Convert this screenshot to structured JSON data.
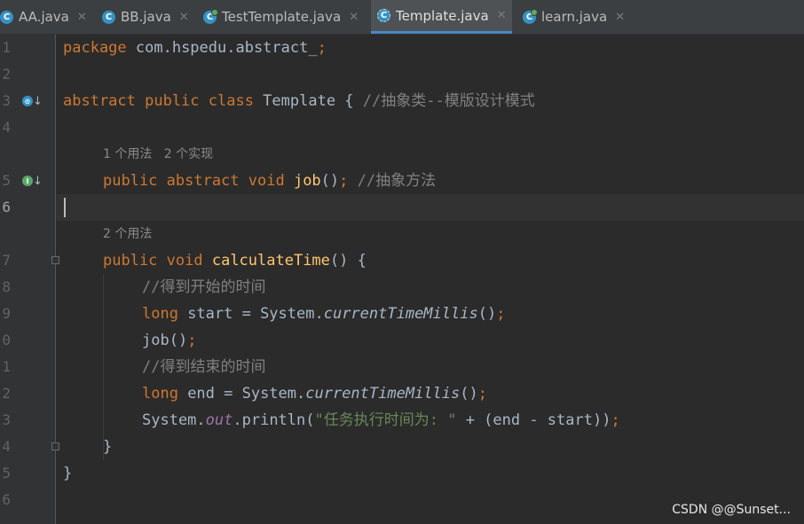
{
  "tabs": [
    {
      "label": "AA.java",
      "icon": "class-icon",
      "active": false
    },
    {
      "label": "BB.java",
      "icon": "class-icon",
      "active": false
    },
    {
      "label": "TestTemplate.java",
      "icon": "runnable-class-icon",
      "active": false
    },
    {
      "label": "Template.java",
      "icon": "abstract-class-icon",
      "active": true
    },
    {
      "label": "learn.java",
      "icon": "runnable-class-icon",
      "active": false
    }
  ],
  "tab_icon_letter": "C",
  "close_glyph": "✕",
  "editor": {
    "current_line": "6",
    "line_numbers": [
      "1",
      "2",
      "3",
      "4",
      "5",
      "6",
      "7",
      "8",
      "9",
      "0",
      "1",
      "2",
      "3",
      "4",
      "5",
      "6"
    ],
    "hints": {
      "abstract_method": "1 个用法   2 个实现",
      "calculate_time": "2 个用法"
    },
    "code": {
      "l1_kw": "package",
      "l1_rest": " com.hspedu.abstract_",
      "l1_semi": ";",
      "l3_kw": "abstract public class",
      "l3_name": " Template { ",
      "l3_comment": "//抽象类--模版设计模式",
      "l5_kw": "public abstract void",
      "l5_fn": "job",
      "l5_paren": "()",
      "l5_semi": ";",
      "l5_comment": " //抽象方法",
      "l7_kw": "public void",
      "l7_fn": "calculateTime",
      "l7_rest": "() {",
      "l8_comment": "//得到开始的时间",
      "l9_kw": "long",
      "l9_rest": " start = System.",
      "l9_method": "currentTimeMillis",
      "l9_paren": "()",
      "l9_semi": ";",
      "l10_call": "job()",
      "l10_semi": ";",
      "l11_comment": "//得到结束的时间",
      "l12_kw": "long",
      "l12_rest": " end = System.",
      "l12_method": "currentTimeMillis",
      "l12_paren": "()",
      "l12_semi": ";",
      "l13_pre": "System.",
      "l13_field": "out",
      "l13_mid": ".println(",
      "l13_str": "\"任务执行时间为: \"",
      "l13_end": " + (end - start))",
      "l13_semi": ";",
      "l14_brace": "}",
      "l15_brace": "}"
    },
    "gutter_glyph_blue": "⊙",
    "gutter_glyph_green": "I",
    "gutter_arrow": "↓"
  },
  "watermark": "CSDN @@Sunset...",
  "colors": {
    "background": "#2b2b2b",
    "keyword": "#cc7832",
    "function": "#ffc66d",
    "comment": "#808080",
    "string": "#6a8759",
    "field": "#9876aa",
    "accent": "#4a88c7"
  }
}
